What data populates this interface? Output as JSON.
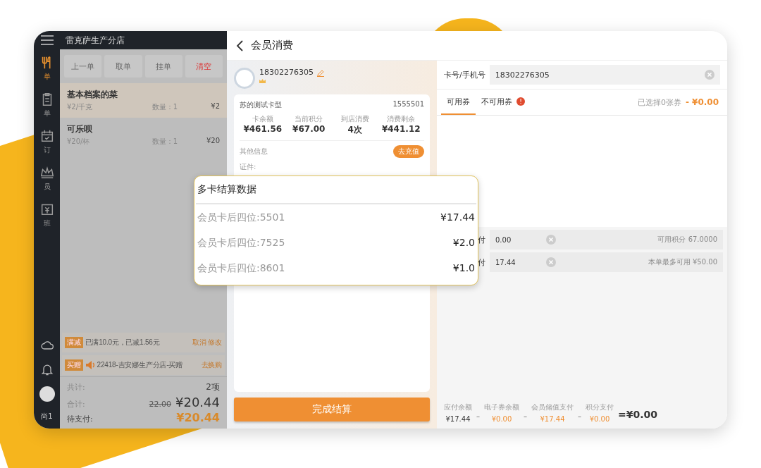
{
  "sidebar": {
    "items": [
      {
        "label": "单",
        "selected": true
      },
      {
        "label": "单",
        "selected": false
      },
      {
        "label": "订",
        "selected": false
      },
      {
        "label": "员",
        "selected": false
      },
      {
        "label": "班",
        "selected": false
      }
    ],
    "user": "尚1"
  },
  "store_name": "雷克萨生产分店",
  "order_actions": [
    {
      "label": "上一单",
      "kind": "normal"
    },
    {
      "label": "取单",
      "kind": "normal"
    },
    {
      "label": "挂单",
      "kind": "normal"
    },
    {
      "label": "清空",
      "kind": "danger"
    }
  ],
  "order_items": [
    {
      "name": "基本档案的菜",
      "unit_price": "¥2/千克",
      "quantity": "数量：1",
      "price": "¥2",
      "selected": true
    },
    {
      "name": "可乐呗",
      "unit_price": "¥20/杯",
      "quantity": "数量：1",
      "price": "¥20",
      "selected": false
    }
  ],
  "promotions": [
    {
      "kind": "discount",
      "tag": "满减",
      "text": "已满10.0元，已减1.56元",
      "actions": [
        "取消",
        "修改"
      ]
    },
    {
      "kind": "gift",
      "tag": "买赠",
      "text": "22418-吉安娜生产分店-买赠",
      "actions": [
        "去换购"
      ]
    }
  ],
  "totals": {
    "count_label": "共计:",
    "count": "2项",
    "sum_label": "合计:",
    "original": "22.00",
    "sum": "¥20.44",
    "due_label": "待支付:",
    "due": "¥20.44"
  },
  "page_title": "会员消费",
  "member": {
    "phone": "18302276305",
    "card_type": "苏的测试卡型",
    "card_no": "1555501",
    "stats": [
      {
        "label": "卡余额",
        "value": "¥461.56"
      },
      {
        "label": "当前积分",
        "value": "¥67.00"
      },
      {
        "label": "到店消费",
        "value": "4次"
      },
      {
        "label": "消费剩余",
        "value": "¥441.12"
      }
    ],
    "other_label": "其他信息",
    "recharge_button": "去充值",
    "id_label": "证件:"
  },
  "complete_button": "完成结算",
  "lookup": {
    "label": "卡号/手机号",
    "value": "18302276305"
  },
  "coupon_tabs": [
    {
      "label": "可用券",
      "selected": true
    },
    {
      "label": "不可用券",
      "selected": false,
      "badge": "!"
    }
  ],
  "coupon_summary": {
    "text": "已选择0张券",
    "amount": "- ¥0.00"
  },
  "payment_rows": [
    {
      "label": "付",
      "value": "0.00",
      "note": "可用积分  67.0000"
    },
    {
      "label": "付",
      "value": "17.44",
      "note": "本单最多可用 ¥50.00"
    }
  ],
  "settlement": {
    "items": [
      {
        "label": "应付余额",
        "value": "¥17.44",
        "highlight": false
      },
      {
        "label": "电子券余额",
        "value": "¥0.00",
        "highlight": true
      },
      {
        "label": "会员储值支付",
        "value": "¥17.44",
        "highlight": true
      },
      {
        "label": "积分支付",
        "value": "¥0.00",
        "highlight": true
      }
    ],
    "operator": "–",
    "result": "=¥0.00"
  },
  "popup": {
    "title": "多卡结算数据",
    "rows": [
      {
        "label": "会员卡后四位:5501",
        "amount": "¥17.44"
      },
      {
        "label": "会员卡后四位:7525",
        "amount": "¥2.0"
      },
      {
        "label": "会员卡后四位:8601",
        "amount": "¥1.0"
      }
    ]
  }
}
